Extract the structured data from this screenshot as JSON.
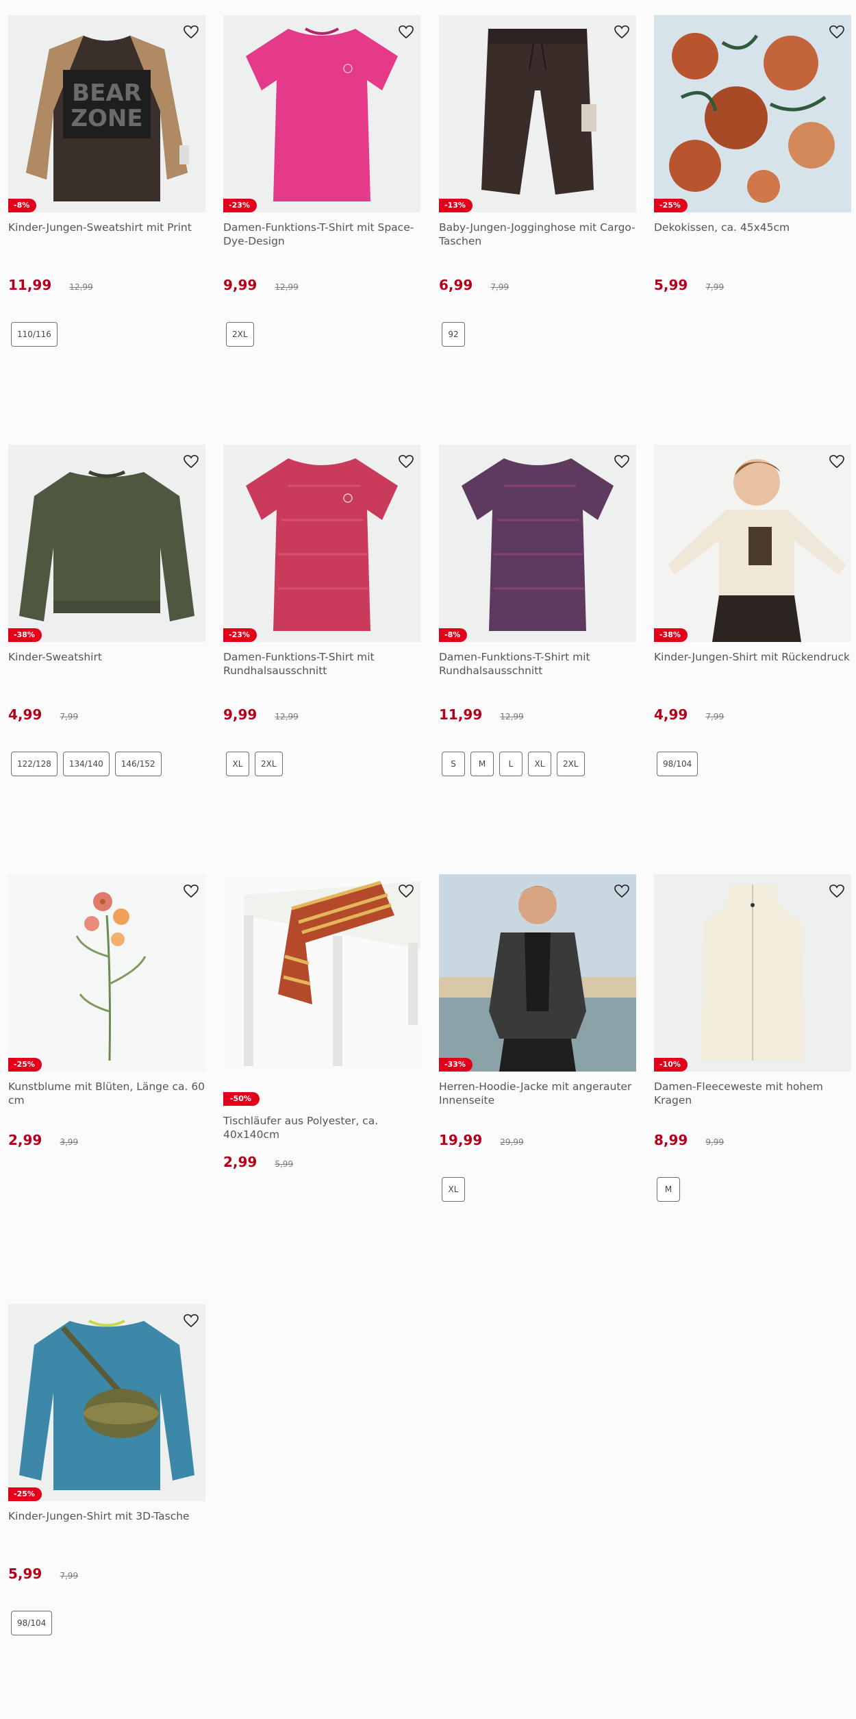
{
  "colors": {
    "sale_red": "#e2001a",
    "price_red": "#b3001b"
  },
  "products": [
    {
      "title": "Kinder-Jungen-Sweatshirt mit Print",
      "discount": "-8%",
      "price": "11,99",
      "old_price": "12,99",
      "sizes": [
        "110/116"
      ],
      "image_icon": "sweatshirt-bear-zone-image"
    },
    {
      "title": "Damen-Funktions-T-Shirt mit Space-Dye-Design",
      "discount": "-23%",
      "price": "9,99",
      "old_price": "12,99",
      "sizes": [
        "2XL"
      ],
      "image_icon": "pink-tshirt-image"
    },
    {
      "title": "Baby-Jungen-Jogginghose mit Cargo-Taschen",
      "discount": "-13%",
      "price": "6,99",
      "old_price": "7,99",
      "sizes": [
        "92"
      ],
      "image_icon": "jogging-pants-image"
    },
    {
      "title": "Dekokissen, ca. 45x45cm",
      "discount": "-25%",
      "price": "5,99",
      "old_price": "7,99",
      "sizes": [],
      "image_icon": "floral-cushion-image"
    },
    {
      "title": "Kinder-Sweatshirt",
      "discount": "-38%",
      "price": "4,99",
      "old_price": "7,99",
      "sizes": [
        "122/128",
        "134/140",
        "146/152"
      ],
      "image_icon": "olive-sweatshirt-image"
    },
    {
      "title": "Damen-Funktions-T-Shirt mit Rundhalsausschnitt",
      "discount": "-23%",
      "price": "9,99",
      "old_price": "12,99",
      "sizes": [
        "XL",
        "2XL"
      ],
      "image_icon": "red-tshirt-image"
    },
    {
      "title": "Damen-Funktions-T-Shirt mit Rundhalsausschnitt",
      "discount": "-8%",
      "price": "11,99",
      "old_price": "12,99",
      "sizes": [
        "S",
        "M",
        "L",
        "XL",
        "2XL"
      ],
      "image_icon": "purple-tshirt-image"
    },
    {
      "title": "Kinder-Jungen-Shirt mit Rückendruck",
      "discount": "-38%",
      "price": "4,99",
      "old_price": "7,99",
      "sizes": [
        "98/104"
      ],
      "image_icon": "boy-shirt-image"
    },
    {
      "title": "Kunstblume mit Blüten, Länge ca. 60 cm",
      "discount": "-25%",
      "price": "2,99",
      "old_price": "3,99",
      "sizes": [],
      "image_icon": "artificial-flower-image"
    },
    {
      "title": "Tischläufer aus Polyester, ca. 40x140cm",
      "discount": "-50%",
      "price": "2,99",
      "old_price": "5,99",
      "sizes": [],
      "image_icon": "table-runner-image"
    },
    {
      "title": "Herren-Hoodie-Jacke mit angerauter Innenseite",
      "discount": "-33%",
      "price": "19,99",
      "old_price": "29,99",
      "sizes": [
        "XL"
      ],
      "image_icon": "hoodie-jacket-image"
    },
    {
      "title": "Damen-Fleeceweste mit hohem Kragen",
      "discount": "-10%",
      "price": "8,99",
      "old_price": "9,99",
      "sizes": [
        "M"
      ],
      "image_icon": "fleece-vest-image"
    },
    {
      "title": "Kinder-Jungen-Shirt mit 3D-Tasche",
      "discount": "-25%",
      "price": "5,99",
      "old_price": "7,99",
      "sizes": [
        "98/104"
      ],
      "image_icon": "shirt-with-bag-image"
    }
  ]
}
